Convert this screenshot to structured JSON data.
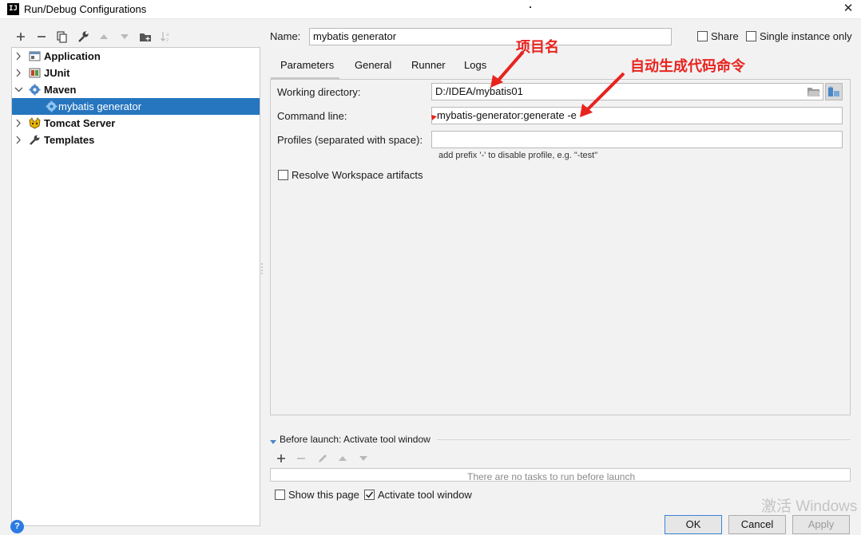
{
  "window": {
    "title": "Run/Debug Configurations",
    "app_icon_text": "IJ",
    "close_glyph": "✕"
  },
  "toolbar": {
    "icons": [
      "add-icon",
      "remove-icon",
      "copy-icon",
      "wrench-icon",
      "arrow-up-icon",
      "arrow-down-icon",
      "folder-icon",
      "sort-icon"
    ]
  },
  "tree": {
    "items": [
      {
        "label": "Application",
        "icon": "application-icon"
      },
      {
        "label": "JUnit",
        "icon": "junit-icon"
      },
      {
        "label": "Maven",
        "icon": "maven-gear-icon"
      },
      {
        "label": "mybatis generator",
        "icon": "gear-icon"
      },
      {
        "label": "Tomcat Server",
        "icon": "tomcat-icon"
      },
      {
        "label": "Templates",
        "icon": "wrench-icon"
      }
    ]
  },
  "form": {
    "name_label": "Name:",
    "name_value": "mybatis generator",
    "share_label": "Share",
    "single_instance_label": "Single instance only",
    "tabs": [
      "Parameters",
      "General",
      "Runner",
      "Logs"
    ],
    "working_dir_label": "Working directory:",
    "working_dir_value": "D:/IDEA/mybatis01",
    "command_line_label": "Command line:",
    "command_line_value": "mybatis-generator:generate -e",
    "profiles_label": "Profiles (separated with space):",
    "profiles_value": "",
    "profiles_hint": "add prefix '-' to disable profile, e.g. \"-test\"",
    "resolve_label": "Resolve Workspace artifacts"
  },
  "annotations": {
    "project_name": "项目名",
    "generate_command": "自动生成代码命令"
  },
  "before_launch": {
    "title": "Before launch: Activate tool window",
    "empty_text": "There are no tasks to run before launch",
    "show_page_label": "Show this page",
    "activate_label": "Activate tool window"
  },
  "buttons": {
    "ok": "OK",
    "cancel": "Cancel",
    "apply": "Apply"
  },
  "overlay": {
    "activate_windows": "激活 Windows"
  },
  "colors": {
    "selection": "#2675bf",
    "annotation_red": "#e8231e"
  }
}
